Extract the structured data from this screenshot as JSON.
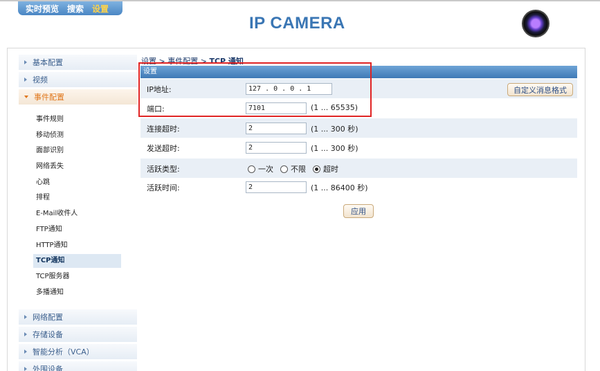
{
  "topnav": {
    "items": [
      "实时预览",
      "搜索",
      "设置"
    ],
    "active": "设置"
  },
  "brand": "IP CAMERA",
  "sidebar": {
    "groups_top": [
      "基本配置",
      "视频"
    ],
    "open_group": "事件配置",
    "sub_items": [
      "事件规则",
      "移动侦测",
      "面部识别",
      "网络丢失",
      "心跳",
      "排程",
      "E-Mail收件人",
      "FTP通知",
      "HTTP通知",
      "TCP通知",
      "TCP服务器",
      "多播通知"
    ],
    "active_item": "TCP通知",
    "groups_bottom": [
      "网络配置",
      "存储设备",
      "智能分析（VCA）",
      "外围设备"
    ]
  },
  "breadcrumb": {
    "part1": "设置",
    "sep": " > ",
    "part2": "事件配置",
    "current": "TCP 通知"
  },
  "section_title": "设置",
  "form": {
    "ip_label": "IP地址:",
    "ip_value": "127 .  0  .  0  .  1",
    "custom_button": "自定义消息格式",
    "port_label": "端口:",
    "port_value": "7101",
    "port_hint": "(1 ... 65535)",
    "connect_timeout_label": "连接超时:",
    "connect_timeout_value": "2",
    "connect_timeout_hint": "(1 ... 300 秒)",
    "send_timeout_label": "发送超时:",
    "send_timeout_value": "2",
    "send_timeout_hint": "(1 ... 300 秒)",
    "active_type_label": "活跃类型:",
    "active_type_options": [
      "一次",
      "不限",
      "超时"
    ],
    "active_type_selected": "超时",
    "active_time_label": "活跃时间:",
    "active_time_value": "2",
    "active_time_hint": "(1 ... 86400 秒)",
    "apply_button": "应用"
  },
  "colors": {
    "accent": "#3a76b4",
    "highlight": "#e02424",
    "active_nav": "#ffd34a"
  }
}
